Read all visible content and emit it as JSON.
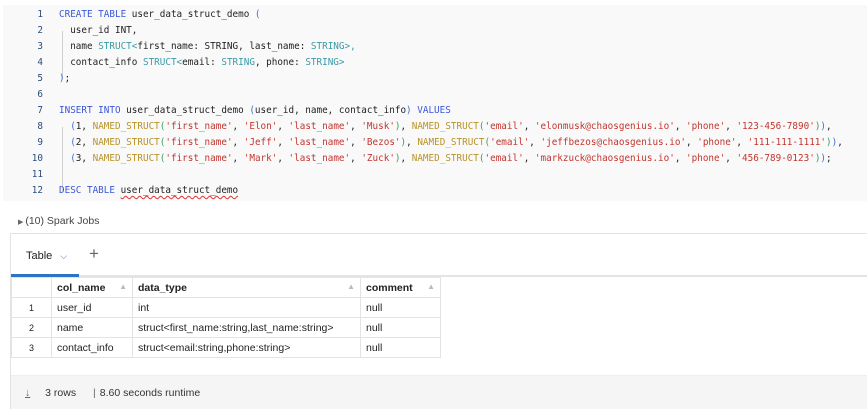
{
  "editor": {
    "lines": [
      {
        "n": "1",
        "t": [
          [
            "CREATE TABLE ",
            "kw"
          ],
          [
            "user_data_struct_demo ",
            ""
          ],
          [
            "(",
            "p1"
          ]
        ]
      },
      {
        "n": "2",
        "t": [
          [
            "  user_id ",
            ""
          ],
          [
            "INT",
            ""
          ],
          [
            ",",
            ""
          ]
        ]
      },
      {
        "n": "3",
        "t": [
          [
            "  name ",
            ""
          ],
          [
            "STRUCT<",
            "ty"
          ],
          [
            "first_name: ",
            ""
          ],
          [
            "STRING",
            ""
          ],
          [
            ", last_name: ",
            ""
          ],
          [
            "STRING",
            "ty"
          ],
          [
            ">,",
            "ty"
          ]
        ]
      },
      {
        "n": "4",
        "t": [
          [
            "  contact_info ",
            ""
          ],
          [
            "STRUCT<",
            "ty"
          ],
          [
            "email: ",
            ""
          ],
          [
            "STRING",
            "ty"
          ],
          [
            ", phone: ",
            ""
          ],
          [
            "STRING",
            "ty"
          ],
          [
            ">",
            "ty"
          ]
        ]
      },
      {
        "n": "5",
        "t": [
          [
            ")",
            "p1"
          ],
          [
            ";",
            ""
          ]
        ]
      },
      {
        "n": "6",
        "t": []
      },
      {
        "n": "7",
        "t": [
          [
            "INSERT INTO ",
            "kw"
          ],
          [
            "user_data_struct_demo ",
            ""
          ],
          [
            "(",
            "p1"
          ],
          [
            "user_id, name, contact_info",
            ""
          ],
          [
            ")",
            "p1"
          ],
          [
            " VALUES",
            "kw"
          ]
        ]
      },
      {
        "n": "8",
        "t": [
          [
            "  (",
            "p1"
          ],
          [
            "1, ",
            ""
          ],
          [
            "NAMED_STRUCT",
            "fn"
          ],
          [
            "(",
            "p2"
          ],
          [
            "'first_name'",
            "st"
          ],
          [
            ", ",
            ""
          ],
          [
            "'Elon'",
            "st"
          ],
          [
            ", ",
            ""
          ],
          [
            "'last_name'",
            "st"
          ],
          [
            ", ",
            ""
          ],
          [
            "'Musk'",
            "st"
          ],
          [
            ")",
            "p2"
          ],
          [
            ", ",
            ""
          ],
          [
            "NAMED_STRUCT",
            "fn"
          ],
          [
            "(",
            "p2"
          ],
          [
            "'email'",
            "st"
          ],
          [
            ", ",
            ""
          ],
          [
            "'elonmusk@chaosgenius.io'",
            "st"
          ],
          [
            ", ",
            ""
          ],
          [
            "'phone'",
            "st"
          ],
          [
            ", ",
            ""
          ],
          [
            "'123-456-7890'",
            "st"
          ],
          [
            ")",
            "p2"
          ],
          [
            ")",
            "p1"
          ],
          [
            ",",
            ""
          ]
        ]
      },
      {
        "n": "9",
        "t": [
          [
            "  (",
            "p1"
          ],
          [
            "2, ",
            ""
          ],
          [
            "NAMED_STRUCT",
            "fn"
          ],
          [
            "(",
            "p2"
          ],
          [
            "'first_name'",
            "st"
          ],
          [
            ", ",
            ""
          ],
          [
            "'Jeff'",
            "st"
          ],
          [
            ", ",
            ""
          ],
          [
            "'last_name'",
            "st"
          ],
          [
            ", ",
            ""
          ],
          [
            "'Bezos'",
            "st"
          ],
          [
            ")",
            "p2"
          ],
          [
            ", ",
            ""
          ],
          [
            "NAMED_STRUCT",
            "fn"
          ],
          [
            "(",
            "p2"
          ],
          [
            "'email'",
            "st"
          ],
          [
            ", ",
            ""
          ],
          [
            "'jeffbezos@chaosgenius.io'",
            "st"
          ],
          [
            ", ",
            ""
          ],
          [
            "'phone'",
            "st"
          ],
          [
            ", ",
            ""
          ],
          [
            "'111-111-1111'",
            "st"
          ],
          [
            ")",
            "p2"
          ],
          [
            ")",
            "p1"
          ],
          [
            ",",
            ""
          ]
        ]
      },
      {
        "n": "10",
        "t": [
          [
            "  (",
            "p1"
          ],
          [
            "3, ",
            ""
          ],
          [
            "NAMED_STRUCT",
            "fn"
          ],
          [
            "(",
            "p2"
          ],
          [
            "'first_name'",
            "st"
          ],
          [
            ", ",
            ""
          ],
          [
            "'Mark'",
            "st"
          ],
          [
            ", ",
            ""
          ],
          [
            "'last_name'",
            "st"
          ],
          [
            ", ",
            ""
          ],
          [
            "'Zuck'",
            "st"
          ],
          [
            ")",
            "p2"
          ],
          [
            ", ",
            ""
          ],
          [
            "NAMED_STRUCT",
            "fn"
          ],
          [
            "(",
            "p2"
          ],
          [
            "'email'",
            "st"
          ],
          [
            ", ",
            ""
          ],
          [
            "'markzuck@chaosgenius.io'",
            "st"
          ],
          [
            ", ",
            ""
          ],
          [
            "'phone'",
            "st"
          ],
          [
            ", ",
            ""
          ],
          [
            "'456-789-0123'",
            "st"
          ],
          [
            ")",
            "p2"
          ],
          [
            ")",
            "p1"
          ],
          [
            ";",
            ""
          ]
        ]
      },
      {
        "n": "11",
        "t": []
      },
      {
        "n": "12",
        "t": [
          [
            "DESC TABLE ",
            "kw"
          ],
          [
            "user_data_struct_demo",
            "squig"
          ]
        ]
      }
    ]
  },
  "spark_jobs": "(10) Spark Jobs",
  "results": {
    "tab_label": "Table",
    "columns": [
      "col_name",
      "data_type",
      "comment"
    ],
    "rows": [
      {
        "n": "1",
        "cells": [
          "user_id",
          "int",
          "null"
        ]
      },
      {
        "n": "2",
        "cells": [
          "name",
          "struct<first_name:string,last_name:string>",
          "null"
        ]
      },
      {
        "n": "3",
        "cells": [
          "contact_info",
          "struct<email:string,phone:string>",
          "null"
        ]
      }
    ],
    "row_count": "3 rows",
    "runtime": "8.60 seconds runtime"
  }
}
